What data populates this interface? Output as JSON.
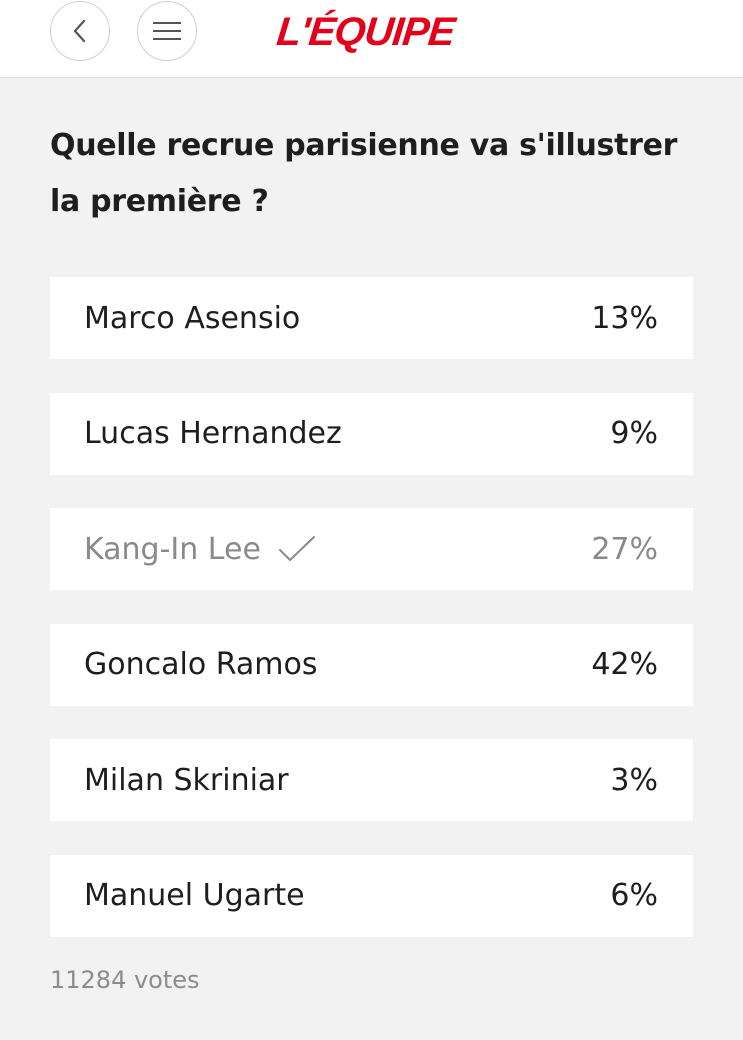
{
  "header": {
    "logo_text": "L'ÉQUIPE",
    "back_icon": "chevron-left-icon",
    "menu_icon": "hamburger-menu-icon",
    "brand_color": "#e3001b"
  },
  "poll": {
    "question": "Quelle recrue parisienne va s'illustrer la première ?",
    "options": [
      {
        "label": "Marco Asensio",
        "percent": "13%"
      },
      {
        "label": "Lucas Hernandez",
        "percent": "9%"
      },
      {
        "label": "Kang-In Lee",
        "percent": "27%",
        "selected": true,
        "icon": "checkmark-icon"
      },
      {
        "label": "Goncalo Ramos",
        "percent": "42%"
      },
      {
        "label": "Milan Skriniar",
        "percent": "3%"
      },
      {
        "label": "Manuel Ugarte",
        "percent": "6%"
      }
    ],
    "votes": "11284 votes"
  }
}
